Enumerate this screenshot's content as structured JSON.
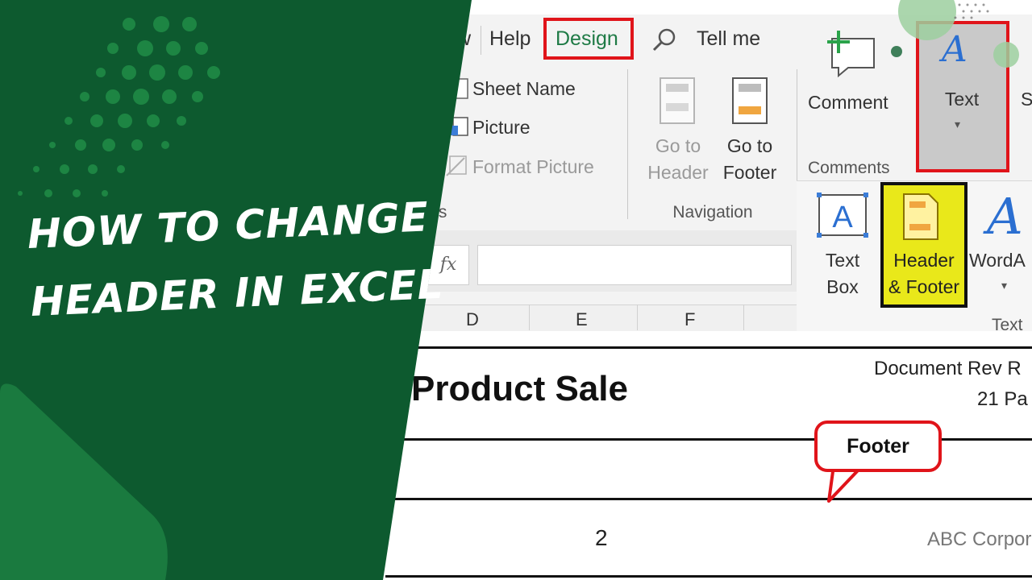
{
  "title": {
    "line1": "HOW TO CHANGE",
    "line2": "HEADER IN EXCEL"
  },
  "ribbon": {
    "tabs": [
      {
        "label": "w"
      },
      {
        "label": "Help"
      },
      {
        "label": "Design"
      },
      {
        "label": "Tell me"
      }
    ],
    "elements_group": {
      "sheet_name": "Sheet Name",
      "picture": "Picture",
      "format_picture": "Format Picture",
      "label_fragment": "ts"
    },
    "navigation_group": {
      "go_to_header_line1": "Go to",
      "go_to_header_line2": "Header",
      "go_to_footer_line1": "Go to",
      "go_to_footer_line2": "Footer",
      "label": "Navigation"
    },
    "comments_group": {
      "comment": "Comment",
      "label": "Comments"
    },
    "text_button": {
      "label": "Text",
      "extra_fragment": "S"
    },
    "text_group": {
      "text_box_line1": "Text",
      "text_box_line2": "Box",
      "header_footer_line1": "Header",
      "header_footer_line2": "& Footer",
      "wordart": "WordA",
      "label": "Text"
    }
  },
  "formula_bar": {
    "fx": "fx",
    "columns": [
      "D",
      "E",
      "F"
    ]
  },
  "document": {
    "heading": "Product Sale",
    "rev_text": "Document Rev R",
    "page_text": "21 Pa",
    "page_number": "2",
    "company": "ABC Corpor"
  },
  "callout": {
    "label": "Footer"
  },
  "colors": {
    "green_dark": "#0d5a2f",
    "green_light": "#1a7a3f",
    "highlight_red": "#e0141a",
    "highlight_yellow": "#e9e81a",
    "excel_green": "#217346"
  }
}
